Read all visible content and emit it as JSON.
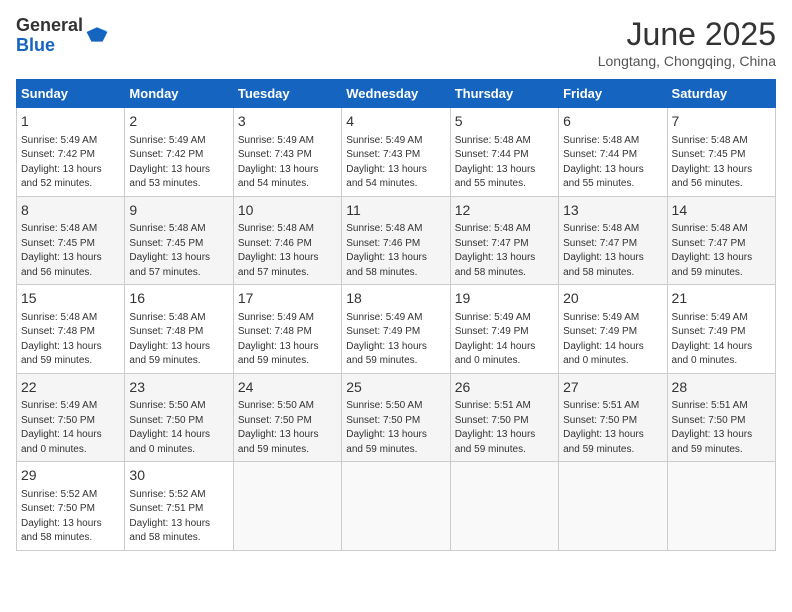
{
  "header": {
    "logo_general": "General",
    "logo_blue": "Blue",
    "month_year": "June 2025",
    "location": "Longtang, Chongqing, China"
  },
  "weekdays": [
    "Sunday",
    "Monday",
    "Tuesday",
    "Wednesday",
    "Thursday",
    "Friday",
    "Saturday"
  ],
  "weeks": [
    [
      {
        "day": "1",
        "info": "Sunrise: 5:49 AM\nSunset: 7:42 PM\nDaylight: 13 hours\nand 52 minutes."
      },
      {
        "day": "2",
        "info": "Sunrise: 5:49 AM\nSunset: 7:42 PM\nDaylight: 13 hours\nand 53 minutes."
      },
      {
        "day": "3",
        "info": "Sunrise: 5:49 AM\nSunset: 7:43 PM\nDaylight: 13 hours\nand 54 minutes."
      },
      {
        "day": "4",
        "info": "Sunrise: 5:49 AM\nSunset: 7:43 PM\nDaylight: 13 hours\nand 54 minutes."
      },
      {
        "day": "5",
        "info": "Sunrise: 5:48 AM\nSunset: 7:44 PM\nDaylight: 13 hours\nand 55 minutes."
      },
      {
        "day": "6",
        "info": "Sunrise: 5:48 AM\nSunset: 7:44 PM\nDaylight: 13 hours\nand 55 minutes."
      },
      {
        "day": "7",
        "info": "Sunrise: 5:48 AM\nSunset: 7:45 PM\nDaylight: 13 hours\nand 56 minutes."
      }
    ],
    [
      {
        "day": "8",
        "info": "Sunrise: 5:48 AM\nSunset: 7:45 PM\nDaylight: 13 hours\nand 56 minutes."
      },
      {
        "day": "9",
        "info": "Sunrise: 5:48 AM\nSunset: 7:45 PM\nDaylight: 13 hours\nand 57 minutes."
      },
      {
        "day": "10",
        "info": "Sunrise: 5:48 AM\nSunset: 7:46 PM\nDaylight: 13 hours\nand 57 minutes."
      },
      {
        "day": "11",
        "info": "Sunrise: 5:48 AM\nSunset: 7:46 PM\nDaylight: 13 hours\nand 58 minutes."
      },
      {
        "day": "12",
        "info": "Sunrise: 5:48 AM\nSunset: 7:47 PM\nDaylight: 13 hours\nand 58 minutes."
      },
      {
        "day": "13",
        "info": "Sunrise: 5:48 AM\nSunset: 7:47 PM\nDaylight: 13 hours\nand 58 minutes."
      },
      {
        "day": "14",
        "info": "Sunrise: 5:48 AM\nSunset: 7:47 PM\nDaylight: 13 hours\nand 59 minutes."
      }
    ],
    [
      {
        "day": "15",
        "info": "Sunrise: 5:48 AM\nSunset: 7:48 PM\nDaylight: 13 hours\nand 59 minutes."
      },
      {
        "day": "16",
        "info": "Sunrise: 5:48 AM\nSunset: 7:48 PM\nDaylight: 13 hours\nand 59 minutes."
      },
      {
        "day": "17",
        "info": "Sunrise: 5:49 AM\nSunset: 7:48 PM\nDaylight: 13 hours\nand 59 minutes."
      },
      {
        "day": "18",
        "info": "Sunrise: 5:49 AM\nSunset: 7:49 PM\nDaylight: 13 hours\nand 59 minutes."
      },
      {
        "day": "19",
        "info": "Sunrise: 5:49 AM\nSunset: 7:49 PM\nDaylight: 14 hours\nand 0 minutes."
      },
      {
        "day": "20",
        "info": "Sunrise: 5:49 AM\nSunset: 7:49 PM\nDaylight: 14 hours\nand 0 minutes."
      },
      {
        "day": "21",
        "info": "Sunrise: 5:49 AM\nSunset: 7:49 PM\nDaylight: 14 hours\nand 0 minutes."
      }
    ],
    [
      {
        "day": "22",
        "info": "Sunrise: 5:49 AM\nSunset: 7:50 PM\nDaylight: 14 hours\nand 0 minutes."
      },
      {
        "day": "23",
        "info": "Sunrise: 5:50 AM\nSunset: 7:50 PM\nDaylight: 14 hours\nand 0 minutes."
      },
      {
        "day": "24",
        "info": "Sunrise: 5:50 AM\nSunset: 7:50 PM\nDaylight: 13 hours\nand 59 minutes."
      },
      {
        "day": "25",
        "info": "Sunrise: 5:50 AM\nSunset: 7:50 PM\nDaylight: 13 hours\nand 59 minutes."
      },
      {
        "day": "26",
        "info": "Sunrise: 5:51 AM\nSunset: 7:50 PM\nDaylight: 13 hours\nand 59 minutes."
      },
      {
        "day": "27",
        "info": "Sunrise: 5:51 AM\nSunset: 7:50 PM\nDaylight: 13 hours\nand 59 minutes."
      },
      {
        "day": "28",
        "info": "Sunrise: 5:51 AM\nSunset: 7:50 PM\nDaylight: 13 hours\nand 59 minutes."
      }
    ],
    [
      {
        "day": "29",
        "info": "Sunrise: 5:52 AM\nSunset: 7:50 PM\nDaylight: 13 hours\nand 58 minutes."
      },
      {
        "day": "30",
        "info": "Sunrise: 5:52 AM\nSunset: 7:51 PM\nDaylight: 13 hours\nand 58 minutes."
      },
      {
        "day": "",
        "info": ""
      },
      {
        "day": "",
        "info": ""
      },
      {
        "day": "",
        "info": ""
      },
      {
        "day": "",
        "info": ""
      },
      {
        "day": "",
        "info": ""
      }
    ]
  ]
}
